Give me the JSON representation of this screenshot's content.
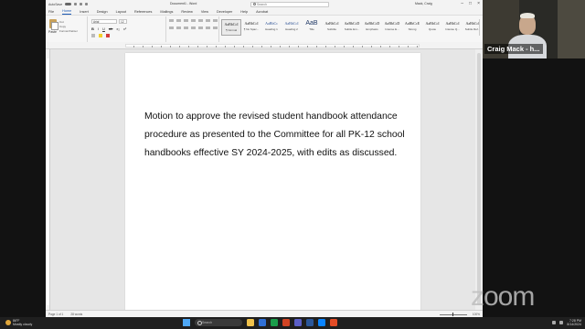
{
  "word": {
    "titlebar": {
      "autosave": "AutoSave",
      "doc_title": "Document1 - Word",
      "search_placeholder": "Search",
      "user": "Mack, Craig"
    },
    "menu_tabs": [
      "File",
      "Home",
      "Insert",
      "Design",
      "Layout",
      "References",
      "Mailings",
      "Review",
      "View",
      "Developer",
      "Help",
      "Acrobat"
    ],
    "active_tab": "Home",
    "ribbon": {
      "paste_label": "Paste",
      "clipboard_items": [
        "Cut",
        "Copy",
        "Format Painter"
      ],
      "font_name": "Arial",
      "font_size": "12",
      "groups": [
        "Clipboard",
        "Font",
        "Paragraph",
        "Styles"
      ],
      "styles": [
        {
          "sample": "AaBbCcI",
          "name": "¶ Normal"
        },
        {
          "sample": "AaBbCcI",
          "name": "¶ No Spac..."
        },
        {
          "sample": "AaBbCc",
          "name": "Heading 1"
        },
        {
          "sample": "AaBbCcI",
          "name": "Heading 2"
        },
        {
          "sample": "AaB",
          "name": "Title"
        },
        {
          "sample": "AaBbCcI",
          "name": "Subtitle"
        },
        {
          "sample": "AaBbCcD",
          "name": "Subtle Em..."
        },
        {
          "sample": "AaBbCcD",
          "name": "Emphasis"
        },
        {
          "sample": "AaBbCcD",
          "name": "Intense E..."
        },
        {
          "sample": "AaBbCcE",
          "name": "Strong"
        },
        {
          "sample": "AaBbCcI",
          "name": "Quote"
        },
        {
          "sample": "AaBbCcI",
          "name": "Intense Q..."
        },
        {
          "sample": "AaBbCcI",
          "name": "Subtle Ref..."
        },
        {
          "sample": "AaBbCcI",
          "name": "Intense..."
        }
      ]
    },
    "document": {
      "text": "Motion to approve the revised student handbook attendance procedure as presented to the Committee for all PK-12 school handbooks effective SY 2024-2025, with edits as discussed."
    },
    "statusbar": {
      "page": "Page 1 of 1",
      "words": "28 words",
      "zoom": "100%"
    }
  },
  "zoom": {
    "participant_name": "Craig Mack - h...",
    "logo": "zoom"
  },
  "taskbar": {
    "weather_temp": "86°F",
    "weather_desc": "Mostly cloudy",
    "search_placeholder": "Search",
    "time": "7:28 PM",
    "date": "8/14/2024",
    "app_colors": [
      "#f0c24b",
      "#2f6fd6",
      "#1b9e4b",
      "#d14424",
      "#5b5fc7",
      "#2b579a",
      "#0a84ff",
      "#e34c26"
    ]
  }
}
